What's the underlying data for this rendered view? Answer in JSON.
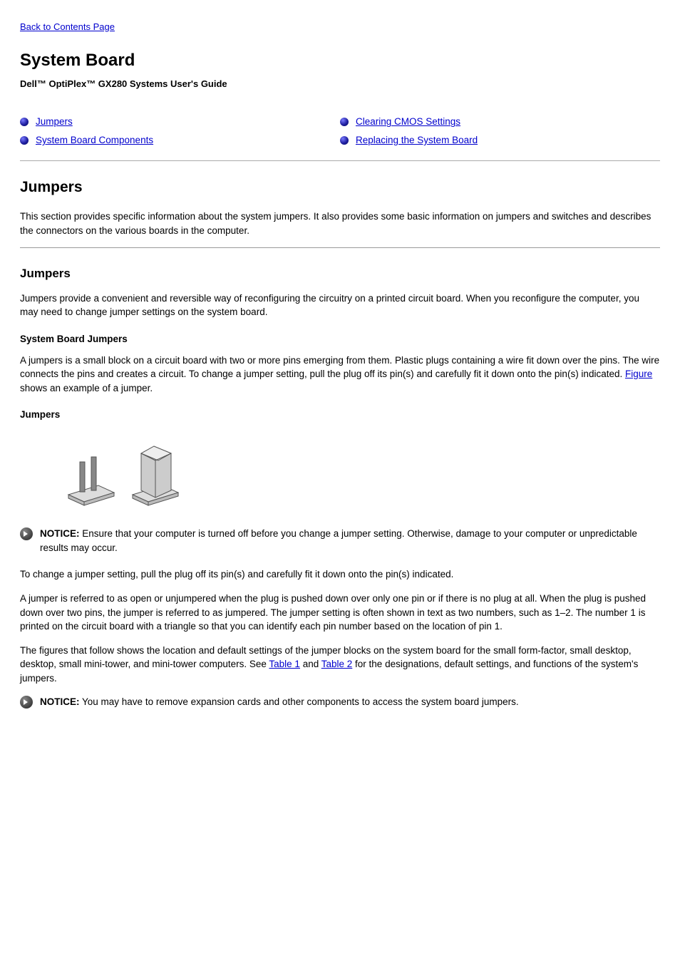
{
  "back_link": "Back to Contents Page",
  "title": "System Board",
  "subtitle": "Dell™ OptiPlex™ GX280 Systems User's Guide",
  "toc": {
    "left": [
      {
        "label": "Jumpers",
        "href": "#jumpers"
      },
      {
        "label": "System Board Components",
        "href": "#components"
      }
    ],
    "right": [
      {
        "label": "Clearing CMOS Settings",
        "href": "#cmos"
      },
      {
        "label": "Replacing the System Board",
        "href": "#replace"
      }
    ]
  },
  "jumpers": {
    "heading": "Jumpers",
    "p1": "This section provides specific information about the system jumpers. It also provides some basic information on jumpers and switches and describes the connectors on the various boards in the computer.",
    "sub_heading": "Jumpers",
    "p2": "Jumpers provide a convenient and reversible way of reconfiguring the circuitry on a printed circuit board. When you reconfigure the computer, you may need to change jumper settings on the system board.",
    "sub_sub": "System Board Jumpers",
    "p3_a": "A jumpers is a small block on a circuit board with two or more pins emerging from them. Plastic plugs containing a wire fit down over the pins. The wire connects the pins and creates a circuit. To change a jumper setting, pull the plug off its pin(s) and carefully fit it down onto the pin(s) indicated. ",
    "p3_link": "Figure",
    "p3_b": " shows an example of a jumper.",
    "figure_caption": "Jumpers",
    "notice1_label": "NOTICE:",
    "notice1_text": " Ensure that your computer is turned off before you change a jumper setting. Otherwise, damage to your computer or unpredictable results may occur.",
    "p4": "To change a jumper setting, pull the plug off its pin(s) and carefully fit it down onto the pin(s) indicated.",
    "p5": "A jumper is referred to as open or unjumpered when the plug is pushed down over only one pin or if there is no plug at all. When the plug is pushed down over two pins, the jumper is referred to as jumpered. The jumper setting is often shown in text as two numbers, such as 1–2. The number 1 is printed on the circuit board with a triangle so that you can identify each pin number based on the location of pin 1.",
    "p6_a": "The figures that follow shows the location and default settings of the jumper blocks on the system board for the small form-factor, small desktop, desktop, small mini-tower, and mini-tower computers. See ",
    "p6_link1": "Table 1",
    "p6_b": " and ",
    "p6_link2": "Table 2",
    "p6_c": " for the designations, default settings, and functions of the system's jumpers.",
    "notice2_label": "NOTICE:",
    "notice2_text": " You may have to remove expansion cards and other components to access the system board jumpers."
  }
}
